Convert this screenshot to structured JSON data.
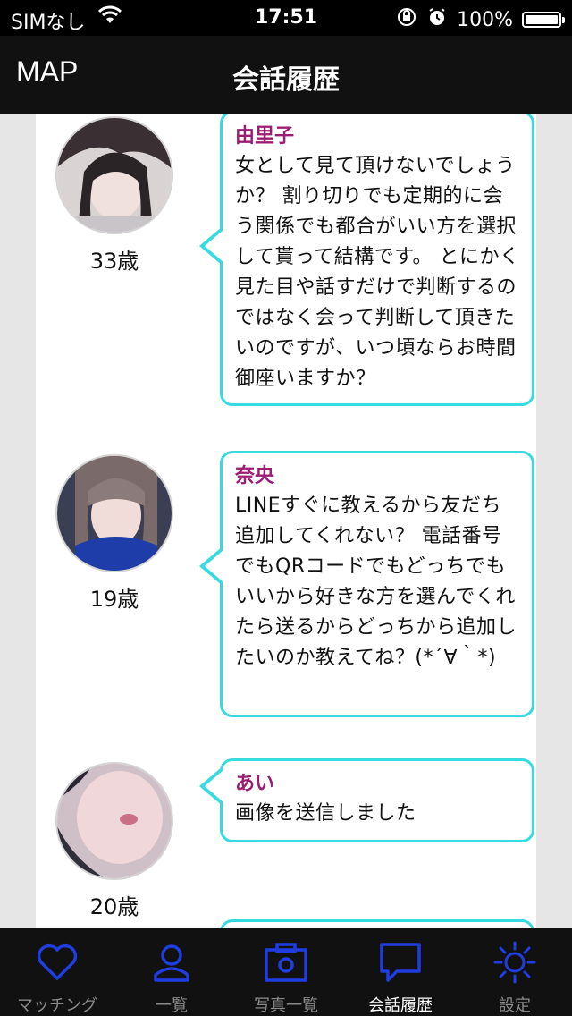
{
  "status_bar": {
    "carrier": "SIMなし",
    "time": "17:51",
    "battery": "100%",
    "battery_level": 1.0
  },
  "nav": {
    "left_label": "MAP",
    "title": "会話履歴"
  },
  "conversations": [
    {
      "name": "由里子",
      "age": "33歳",
      "message": "女として見て頂けないでしょうか？ 割り切りでも定期的に会う関係でも都合がいい方を選択して貰って結構です。 とにかく見た目や話すだけで判断するのではなく会って判断して頂きたいのですが、いつ頃ならお時間御座いますか？"
    },
    {
      "name": "奈央",
      "age": "19歳",
      "message": "LINEすぐに教えるから友だち追加してくれない？ 電話番号でもQRコードでもどっちでもいいから好きな方を選んでくれたら送るからどっちから追加したいのか教えてね？(*´∀｀*)"
    },
    {
      "name": "あい",
      "age": "20歳",
      "message": "画像を送信しました"
    }
  ],
  "tabs": [
    {
      "label": "マッチング",
      "icon": "heart-icon"
    },
    {
      "label": "一覧",
      "icon": "person-icon"
    },
    {
      "label": "写真一覧",
      "icon": "camera-icon"
    },
    {
      "label": "会話履歴",
      "icon": "chat-bubble-icon",
      "active": true
    },
    {
      "label": "設定",
      "icon": "sun-gear-icon"
    }
  ],
  "colors": {
    "accent_blue": "#1f3de0",
    "bubble_border": "#36dbe0",
    "name_color": "#9a1e72"
  }
}
